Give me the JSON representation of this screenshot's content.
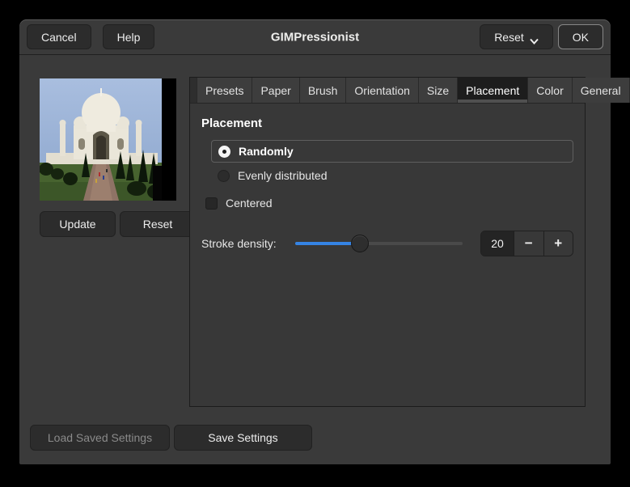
{
  "window": {
    "title": "GIMPressionist"
  },
  "header": {
    "cancel_label": "Cancel",
    "help_label": "Help",
    "reset_label": "Reset",
    "ok_label": "OK"
  },
  "icons": {
    "chevron_down": "chevron-down",
    "minus": "−",
    "plus": "+"
  },
  "preview": {
    "update_label": "Update",
    "reset_label": "Reset"
  },
  "tabs": {
    "items": [
      {
        "label": "Presets",
        "selected": false
      },
      {
        "label": "Paper",
        "selected": false
      },
      {
        "label": "Brush",
        "selected": false
      },
      {
        "label": "Orientation",
        "selected": false
      },
      {
        "label": "Size",
        "selected": false
      },
      {
        "label": "Placement",
        "selected": true
      },
      {
        "label": "Color",
        "selected": false
      },
      {
        "label": "General",
        "selected": false
      }
    ]
  },
  "placement": {
    "heading": "Placement",
    "options": [
      {
        "label": "Randomly",
        "selected": true
      },
      {
        "label": "Evenly distributed",
        "selected": false
      }
    ],
    "centered": {
      "label": "Centered",
      "checked": false
    },
    "stroke_density": {
      "label": "Stroke density:",
      "value": "20",
      "percent": 39
    }
  },
  "footer": {
    "load_label": "Load Saved Settings",
    "load_enabled": false,
    "save_label": "Save Settings"
  },
  "colors": {
    "accent_blue": "#3584e4",
    "dialog_bg": "#3a3a3a",
    "selected_tab_bg": "#1d1d1d",
    "outside_bg": "#000000"
  }
}
